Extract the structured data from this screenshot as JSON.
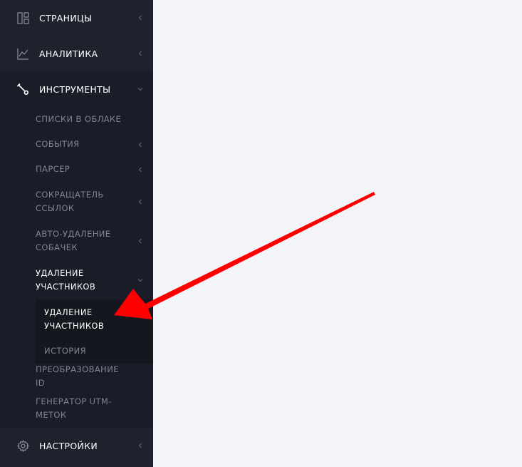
{
  "sidebar": {
    "top_items": [
      {
        "label": "СТРАНИЦЫ",
        "icon": "pages-layout-icon"
      },
      {
        "label": "АНАЛИТИКА",
        "icon": "analytics-chart-icon"
      },
      {
        "label": "ИНСТРУМЕНТЫ",
        "icon": "wrench-icon"
      },
      {
        "label": "НАСТРОЙКИ",
        "icon": "gear-icon"
      }
    ],
    "tools_items": [
      {
        "label": "СПИСКИ В ОБЛАКЕ"
      },
      {
        "label": "СОБЫТИЯ"
      },
      {
        "label": "ПАРСЕР"
      },
      {
        "label": "СОКРАЩАТЕЛЬ ССЫЛОК"
      },
      {
        "label": "АВТО-УДАЛЕНИЕ СОБАЧЕК"
      },
      {
        "label": "УДАЛЕНИЕ УЧАСТНИКОВ"
      },
      {
        "label": "ПРЕОБРАЗОВАНИЕ ID"
      },
      {
        "label": "ГЕНЕРАТОР UTM-МЕТОК"
      }
    ],
    "remove_members_items": [
      {
        "label": "УДАЛЕНИЕ УЧАСТНИКОВ"
      },
      {
        "label": "ИСТОРИЯ"
      }
    ]
  },
  "colors": {
    "sidebar_bg": "#1e222d",
    "submenu_bg": "#1a1d27",
    "subsub_bg": "#15171f",
    "main_bg": "#f3f4f8",
    "annotation_arrow": "#ff0000"
  }
}
